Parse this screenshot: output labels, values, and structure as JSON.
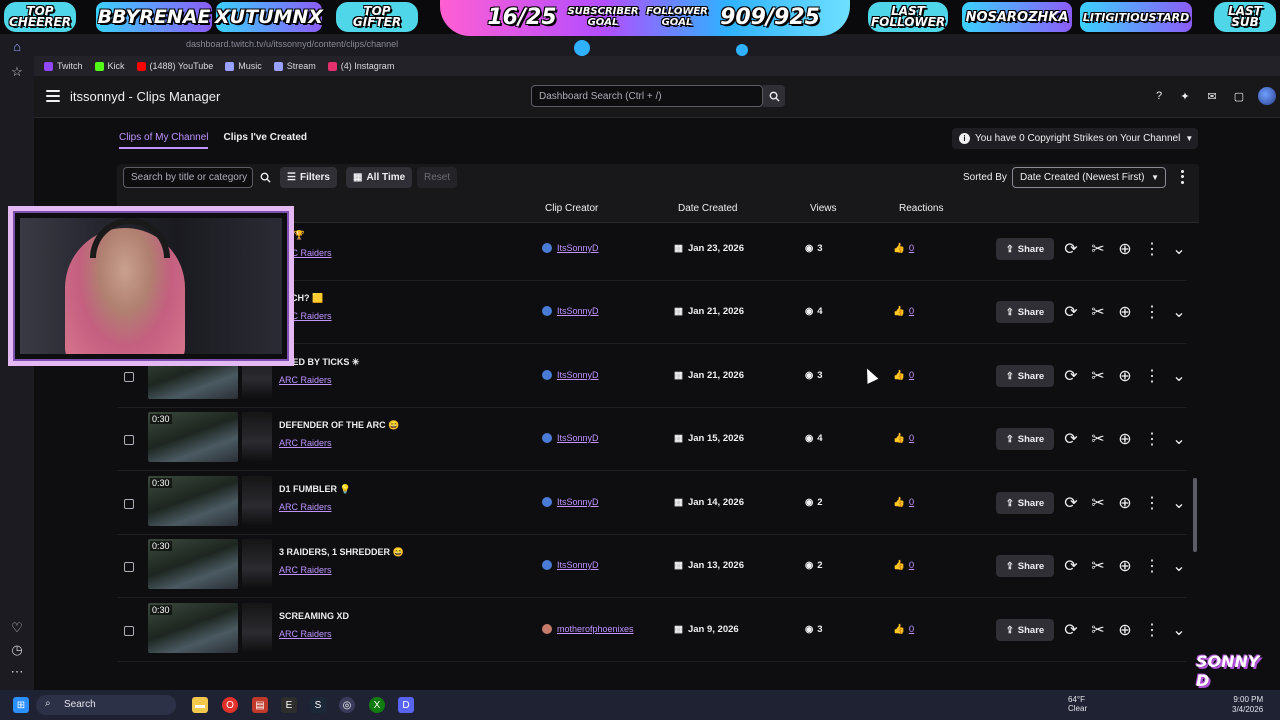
{
  "overlay": {
    "top_cheerer_label": "TOP\nCHEERER",
    "top_cheerer_name": "BBYRENAE",
    "top_gifter_name": "XUTUMNX",
    "top_gifter_label": "TOP\nGIFTER",
    "sub_goal_count": "16/25",
    "sub_goal_label": "SUBSCRIBER\nGOAL",
    "follower_goal_label": "FOLLOWER\nGOAL",
    "follower_goal_count": "909/925",
    "last_follower_label": "LAST\nFOLLOWER",
    "last_follower_name": "NOSAROZHKA",
    "last_sub_name": "LITIGITIOUSTARD",
    "last_sub_label": "LAST\nSUB",
    "brand_logo_text": "SONNY D"
  },
  "browser": {
    "url": "dashboard.twitch.tv/u/itssonnyd/content/clips/channel",
    "bookmarks": [
      {
        "label": "Twitch",
        "color": "#9146ff"
      },
      {
        "label": "Kick",
        "color": "#53fc18"
      },
      {
        "label": "(1488) YouTube",
        "color": "#ff0000"
      },
      {
        "label": "Music",
        "color": "#9aa0ff"
      },
      {
        "label": "Stream",
        "color": "#9aa0ff"
      },
      {
        "label": "(4) Instagram",
        "color": "#e1306c"
      }
    ]
  },
  "header": {
    "title": "itssonnyd - Clips Manager",
    "search_placeholder": "Dashboard Search (Ctrl + /)"
  },
  "tabs": [
    {
      "label": "Clips of My Channel",
      "active": true
    },
    {
      "label": "Clips I've Created",
      "active": false
    }
  ],
  "copyright_notice": "You have 0 Copyright Strikes on Your Channel",
  "toolbar": {
    "search_placeholder": "Search by title or category",
    "filters_label": "Filters",
    "time_label": "All Time",
    "reset_label": "Reset",
    "sorted_by_label": "Sorted By",
    "sort_value": "Date Created (Newest First)"
  },
  "columns": {
    "creator": "Clip Creator",
    "date": "Date Created",
    "views": "Views",
    "reactions": "Reactions"
  },
  "clips": [
    {
      "duration": "",
      "title": "PS 🏆",
      "game": "ARC Raiders",
      "creator": "ItsSonnyD",
      "date": "Jan 23, 2026",
      "views": "3",
      "reactions": "0",
      "share": "Share"
    },
    {
      "duration": "",
      "title": "UTCH? 🟨",
      "game": "ARC Raiders",
      "creator": "ItsSonnyD",
      "date": "Jan 21, 2026",
      "views": "4",
      "reactions": "0",
      "share": "Share"
    },
    {
      "duration": "",
      "title": "MPED BY TICKS ✳",
      "game": "ARC Raiders",
      "creator": "ItsSonnyD",
      "date": "Jan 21, 2026",
      "views": "3",
      "reactions": "0",
      "share": "Share"
    },
    {
      "duration": "0:30",
      "title": "DEFENDER OF THE ARC 😄",
      "game": "ARC Raiders",
      "creator": "ItsSonnyD",
      "date": "Jan 15, 2026",
      "views": "4",
      "reactions": "0",
      "share": "Share"
    },
    {
      "duration": "0:30",
      "title": "D1 FUMBLER 💡",
      "game": "ARC Raiders",
      "creator": "ItsSonnyD",
      "date": "Jan 14, 2026",
      "views": "2",
      "reactions": "0",
      "share": "Share"
    },
    {
      "duration": "0:30",
      "title": "3 RAIDERS, 1 SHREDDER 😄",
      "game": "ARC Raiders",
      "creator": "ItsSonnyD",
      "date": "Jan 13, 2026",
      "views": "2",
      "reactions": "0",
      "share": "Share"
    },
    {
      "duration": "0:30",
      "title": "SCREAMING XD",
      "game": "ARC Raiders",
      "creator": "motherofphoenixes",
      "date": "Jan 9, 2026",
      "views": "3",
      "reactions": "0",
      "share": "Share"
    }
  ],
  "taskbar": {
    "search_label": "Search",
    "weather_temp": "64°F",
    "weather_desc": "Clear",
    "time": "9:00 PM",
    "date": "3/4/2026"
  }
}
